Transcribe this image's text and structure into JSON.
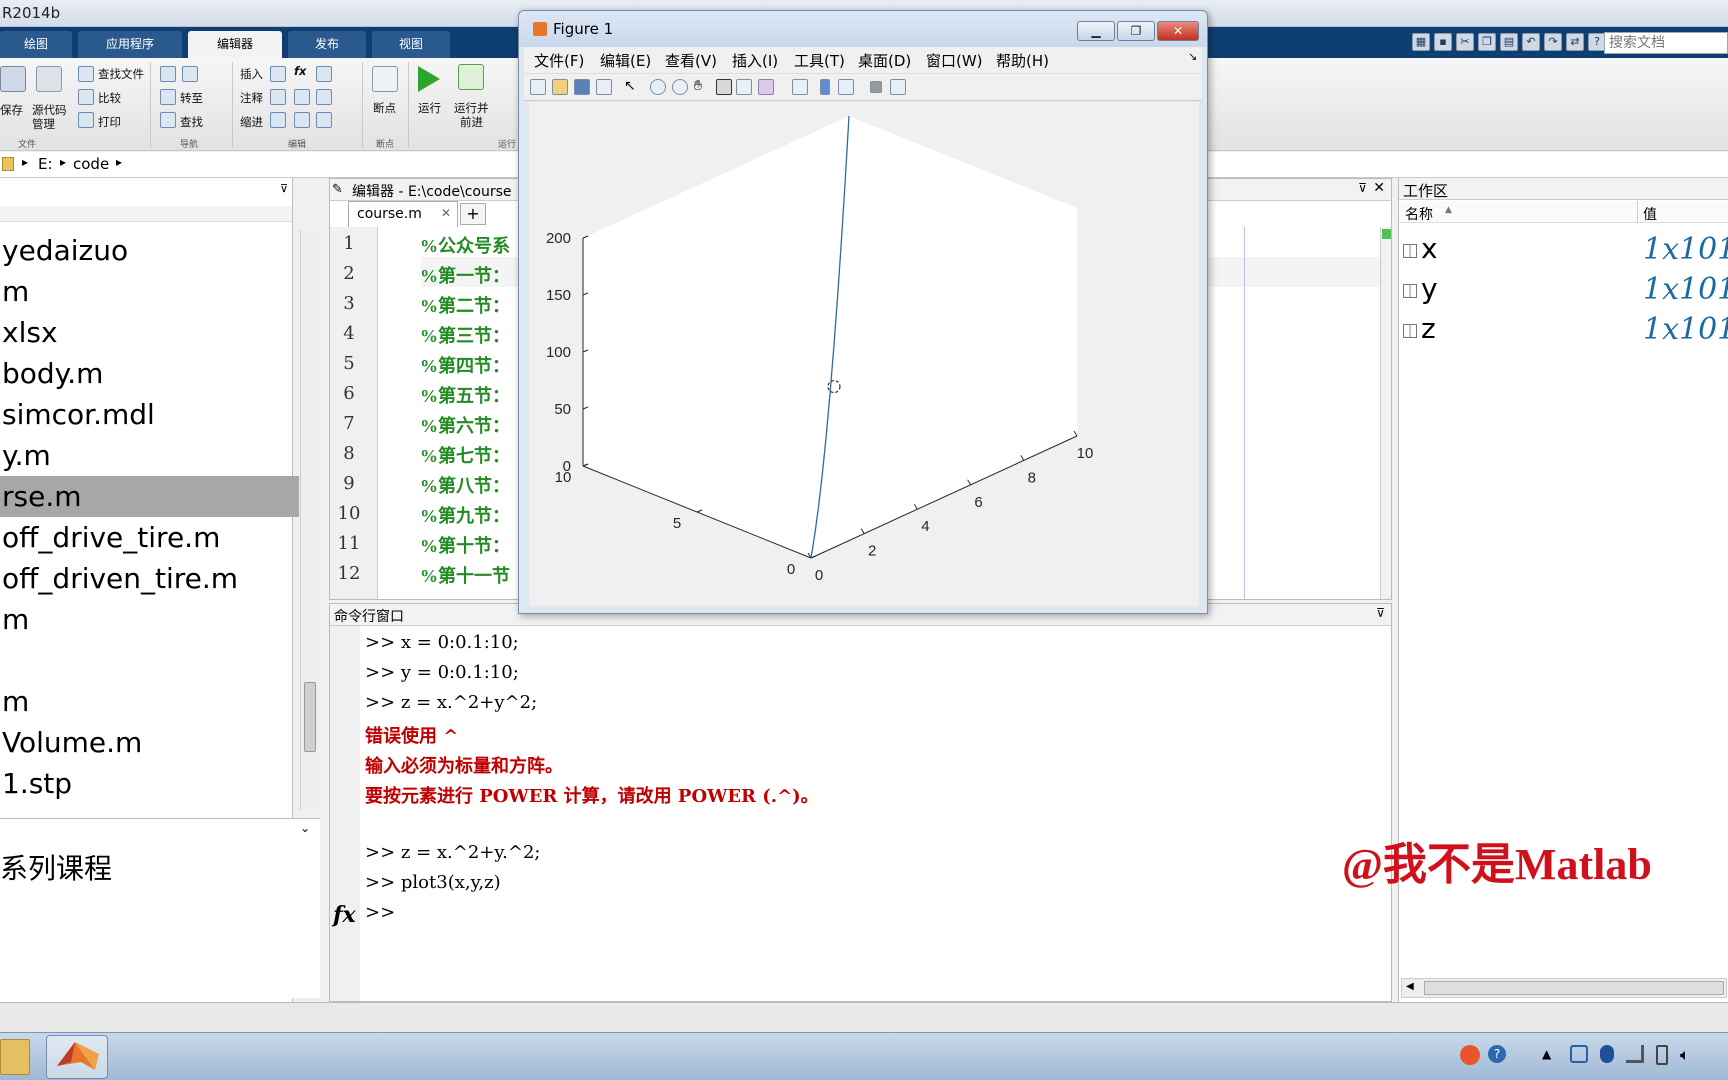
{
  "app": {
    "title": "R2014b"
  },
  "main_tabs": [
    "绘图",
    "应用程序",
    "编辑器",
    "发布",
    "视图"
  ],
  "active_tab": "编辑器",
  "search": {
    "placeholder": "搜索文档"
  },
  "ribbon": {
    "sections": [
      "文件",
      "导航",
      "编辑",
      "断点",
      "运行"
    ],
    "buttons": {
      "save": "保存",
      "find_file": "查找文件",
      "compare": "比较",
      "print": "打印",
      "source_control_1": "源代码",
      "source_control_2": "管理",
      "goto": "转至",
      "find": "查找",
      "insert": "插入",
      "comment": "注释",
      "indent": "缩进",
      "breakpoint": "断点",
      "run": "运行",
      "run_advance_1": "运行并",
      "run_advance_2": "前进"
    }
  },
  "address": {
    "drive": "E:",
    "folder": "code"
  },
  "file_browser": {
    "items": [
      "yedaizuo",
      "m",
      "xlsx",
      "body.m",
      "simcor.mdl",
      "y.m",
      "rse.m",
      "off_drive_tire.m",
      "off_driven_tire.m",
      "m",
      "",
      "m",
      "Volume.m",
      "1.stp"
    ],
    "selected_index": 6,
    "detail_text": "系列课程"
  },
  "editor": {
    "title": "编辑器 - E:\\code\\course",
    "tab": "course.m",
    "add_tab": "+",
    "line_numbers": [
      "1",
      "2",
      "3",
      "4",
      "5",
      "6",
      "7",
      "8",
      "9",
      "10",
      "11",
      "12"
    ],
    "lines": [
      "%公众号系",
      "%第一节：",
      "%第二节：",
      "%第三节：",
      "%第四节：",
      "%第五节：",
      "%第六节：",
      "%第七节：",
      "%第八节：",
      "%第九节：",
      "%第十节：",
      "%第十一节"
    ]
  },
  "command_window": {
    "title": "命令行窗口",
    "lines": [
      {
        "text": ">> x = 0:0.1:10;",
        "type": "input"
      },
      {
        "text": ">> y = 0:0.1:10;",
        "type": "input"
      },
      {
        "text": ">> z = x.^2+y^2;",
        "type": "input"
      },
      {
        "text": "错误使用  ^",
        "type": "error"
      },
      {
        "text": "输入必须为标量和方阵。",
        "type": "error"
      },
      {
        "text": "要按元素进行 POWER 计算，请改用 POWER (.^)。",
        "type": "error"
      },
      {
        "text": "",
        "type": "blank"
      },
      {
        "text": ">> z = x.^2+y.^2;",
        "type": "input"
      },
      {
        "text": ">> plot3(x,y,z)",
        "type": "input"
      }
    ],
    "fx": "fx",
    "prompt": ">>"
  },
  "workspace": {
    "title": "工作区",
    "col_name": "名称",
    "col_value": "值",
    "vars": [
      {
        "name": "x",
        "value": "1x101"
      },
      {
        "name": "y",
        "value": "1x101"
      },
      {
        "name": "z",
        "value": "1x101"
      }
    ]
  },
  "figure": {
    "title": "Figure 1",
    "menu": [
      "文件(F)",
      "编辑(E)",
      "查看(V)",
      "插入(I)",
      "工具(T)",
      "桌面(D)",
      "窗口(W)",
      "帮助(H)"
    ],
    "chart_data": {
      "type": "line",
      "projection": "3d",
      "x": [
        0,
        1,
        2,
        3,
        4,
        5,
        6,
        7,
        8,
        9,
        10
      ],
      "y": [
        0,
        1,
        2,
        3,
        4,
        5,
        6,
        7,
        8,
        9,
        10
      ],
      "z": [
        0,
        2,
        8,
        18,
        32,
        50,
        72,
        98,
        128,
        162,
        200
      ],
      "xlim": [
        0,
        10
      ],
      "ylim": [
        0,
        10
      ],
      "zlim": [
        0,
        200
      ],
      "x_ticks": [
        "0",
        "2",
        "4",
        "6",
        "8",
        "10"
      ],
      "y_ticks": [
        "0",
        "5",
        "10"
      ],
      "z_ticks": [
        "0",
        "50",
        "100",
        "150",
        "200"
      ],
      "line_color": "#2a6f97",
      "grid": false
    }
  },
  "watermark": {
    "text": "@我不是Matlab"
  },
  "colors": {
    "tab_strip": "#0f3e70",
    "comment_green": "#228b22",
    "error_red": "#c00000",
    "watermark_red": "#d0101a",
    "selected_row": "#a7a7a7"
  }
}
